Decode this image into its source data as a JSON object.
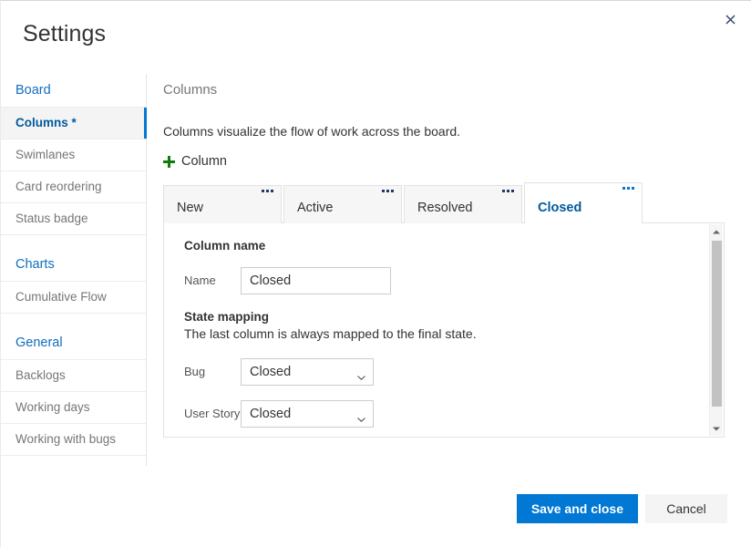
{
  "dialog": {
    "title": "Settings",
    "close_label": "close-icon"
  },
  "sidebar": {
    "groups": [
      {
        "title": "Board",
        "items": [
          {
            "label": "Columns *",
            "selected": true
          },
          {
            "label": "Swimlanes",
            "selected": false
          },
          {
            "label": "Card reordering",
            "selected": false
          },
          {
            "label": "Status badge",
            "selected": false
          }
        ]
      },
      {
        "title": "Charts",
        "items": [
          {
            "label": "Cumulative Flow",
            "selected": false
          }
        ]
      },
      {
        "title": "General",
        "items": [
          {
            "label": "Backlogs",
            "selected": false
          },
          {
            "label": "Working days",
            "selected": false
          },
          {
            "label": "Working with bugs",
            "selected": false
          }
        ]
      }
    ]
  },
  "main": {
    "heading": "Columns",
    "description": "Columns visualize the flow of work across the board.",
    "add_column_label": "Column",
    "tabs": [
      {
        "label": "New",
        "active": false
      },
      {
        "label": "Active",
        "active": false
      },
      {
        "label": "Resolved",
        "active": false
      },
      {
        "label": "Closed",
        "active": true
      }
    ],
    "panel": {
      "column_name_title": "Column name",
      "name_label": "Name",
      "name_value": "Closed",
      "state_mapping_title": "State mapping",
      "state_mapping_desc": "The last column is always mapped to the final state.",
      "mappings": [
        {
          "label": "Bug",
          "value": "Closed"
        },
        {
          "label": "User Story",
          "value": "Closed"
        }
      ]
    }
  },
  "footer": {
    "save_label": "Save and close",
    "cancel_label": "Cancel"
  },
  "colors": {
    "accent": "#0078d4",
    "link": "#106ebe",
    "selected_text": "#005a9e",
    "plus_green": "#107c10"
  }
}
